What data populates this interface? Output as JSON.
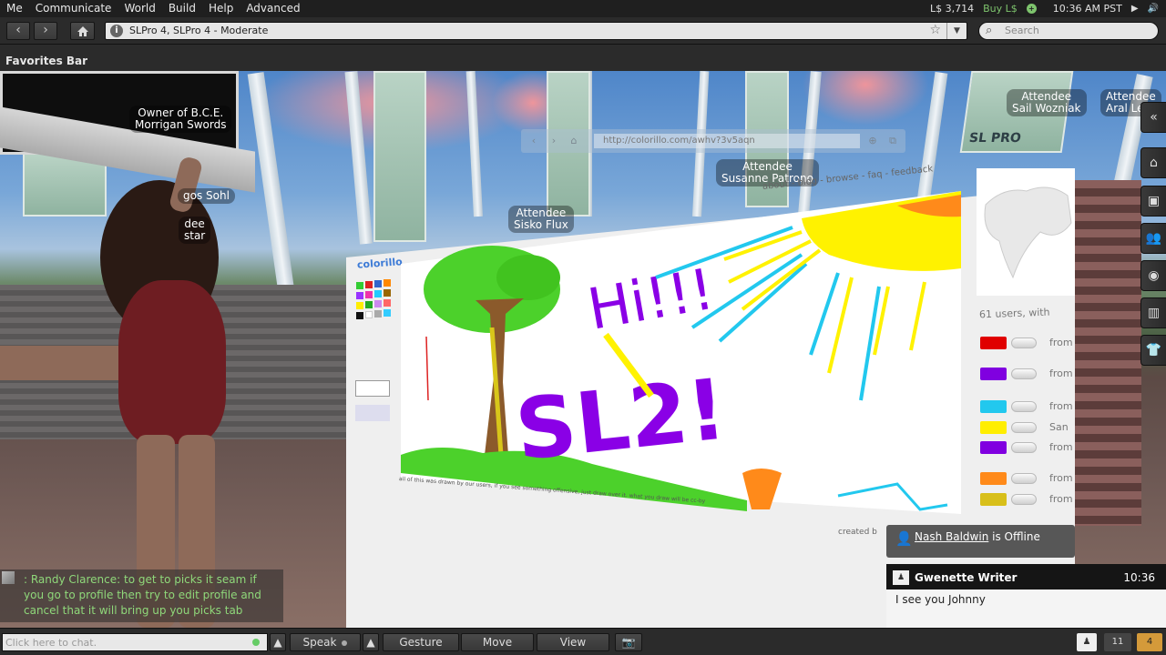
{
  "menu": {
    "items": [
      "Me",
      "Communicate",
      "World",
      "Build",
      "Help",
      "Advanced"
    ],
    "balance": "L$ 3,714",
    "buy_label": "Buy L$",
    "clock": "10:36 AM PST"
  },
  "navbar": {
    "location": "SLPro 4, SLPro 4 - Moderate",
    "search_placeholder": "Search"
  },
  "favorites": {
    "label": "Favorites Bar"
  },
  "scene": {
    "banner_text": "SL PRO",
    "nametags": [
      {
        "line1": "Owner of B.C.E.",
        "line2": "Morrigan Swords"
      },
      {
        "line1": "Attendee",
        "line2": "Sail Wozniak"
      },
      {
        "line1": "Attendee",
        "line2": "Aral Le"
      },
      {
        "line1": "Attendee",
        "line2": "Susanne Patrono"
      },
      {
        "line1": "Attendee",
        "line2": "Sisko Flux"
      },
      {
        "line1": "gos Sohl",
        "line2": ""
      },
      {
        "line1": "dee",
        "line2": "star"
      }
    ]
  },
  "board": {
    "url": "http://colorillo.com/awhv?3v5aqn",
    "links": "about - blog - browse - faq - feedback",
    "logo": "colorillo",
    "users_label": "61 users, with",
    "caption": "all of this was drawn by our users, if you see something offensive, just draw over it. what you draw will be cc-by",
    "created_by": "created b",
    "users": [
      {
        "color": "#e00000",
        "name": "from"
      },
      {
        "color": "#8000e0",
        "name": "from"
      },
      {
        "color": "#22c8ee",
        "name": "from"
      },
      {
        "color": "#ffee00",
        "name": "San"
      },
      {
        "color": "#8000e0",
        "name": "from"
      },
      {
        "color": "#ff8a1a",
        "name": "from"
      },
      {
        "color": "#d8bf1a",
        "name": "from"
      }
    ],
    "drawing": {
      "greeting": "Hi!!!",
      "headline": "SL2!"
    }
  },
  "chat": {
    "message": ": Randy Clarence: to get to picks it seam if you go to profile then try to edit profile and cancel that it will bring up you picks tab"
  },
  "toast": {
    "name": "Nash Baldwin",
    "status": " is Offline"
  },
  "im": {
    "sender": "Gwenette Writer",
    "time": "10:36",
    "message": "I see you Johnny"
  },
  "bottom": {
    "chat_placeholder": "Click here to chat.",
    "speak": "Speak",
    "gesture": "Gesture",
    "move": "Move",
    "view": "View",
    "im_count": "11",
    "notif_count": "4"
  }
}
